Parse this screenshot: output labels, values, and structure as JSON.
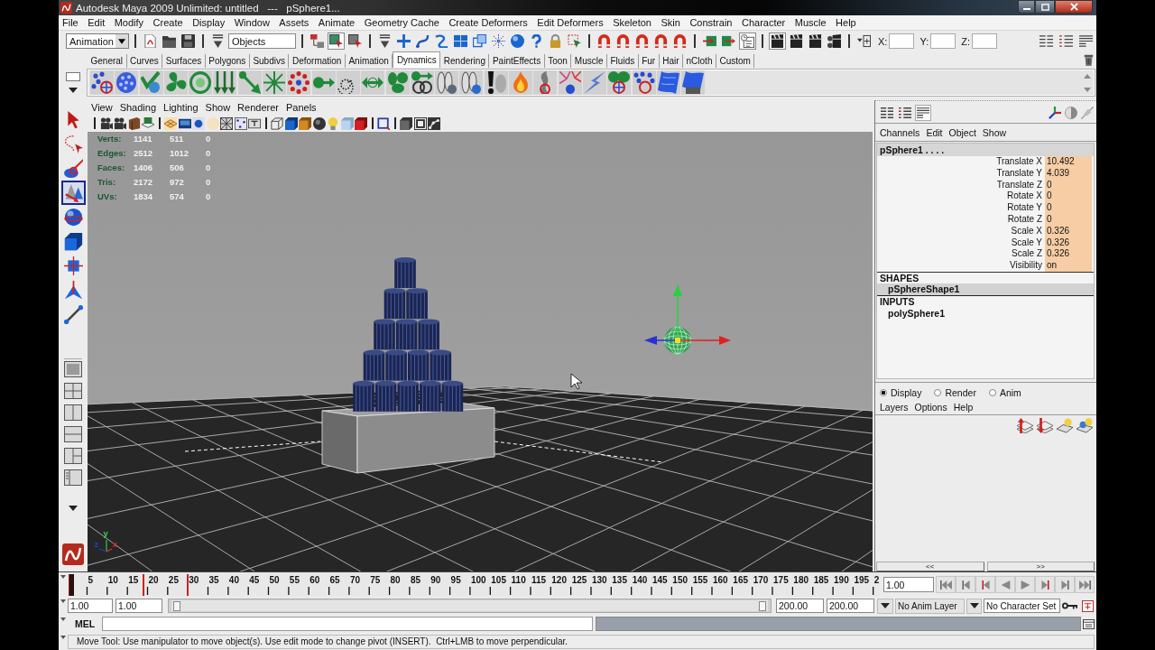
{
  "window": {
    "title": "Autodesk Maya 2009 Unlimited: untitled   ---   pSphere1..."
  },
  "menu_bar": [
    "File",
    "Edit",
    "Modify",
    "Create",
    "Display",
    "Window",
    "Assets",
    "Animate",
    "Geometry Cache",
    "Create Deformers",
    "Edit Deformers",
    "Skeleton",
    "Skin",
    "Constrain",
    "Character",
    "Muscle",
    "Help"
  ],
  "status_line": {
    "menu_set": "Animation",
    "selection_mask": "Objects",
    "buttons": [
      {
        "pressed": false
      },
      {
        "pressed": false
      },
      {
        "pressed": false
      },
      {
        "pressed": false
      },
      {
        "pressed": false
      },
      {
        "pressed": true
      },
      {
        "pressed": false
      },
      {
        "pressed": false
      },
      {
        "pressed": false
      },
      {
        "pressed": false
      },
      {
        "pressed": false
      },
      {
        "pressed": false
      },
      {
        "pressed": false
      },
      {
        "pressed": false
      },
      {
        "pressed": false
      },
      {
        "pressed": false
      },
      {
        "pressed": false
      },
      {
        "pressed": false
      },
      {
        "pressed": false
      },
      {
        "pressed": false
      },
      {
        "pressed": false
      },
      {
        "pressed": false
      },
      {
        "pressed": false
      },
      {
        "pressed": false
      },
      {
        "pressed": false
      },
      {
        "pressed": true
      },
      {
        "pressed": true
      },
      {
        "pressed": false
      },
      {
        "pressed": false
      },
      {
        "pressed": false
      },
      {
        "pressed": false
      },
      {
        "pressed": false
      },
      {
        "pressed": false
      },
      {
        "pressed": false
      }
    ],
    "coordinates": [
      {
        "label": "X:"
      },
      {
        "label": "Y:"
      },
      {
        "label": "Z:"
      }
    ]
  },
  "shelf": {
    "tabs": [
      {
        "label": "General",
        "selected": false
      },
      {
        "label": "Curves",
        "selected": false
      },
      {
        "label": "Surfaces",
        "selected": false
      },
      {
        "label": "Polygons",
        "selected": false
      },
      {
        "label": "Subdivs",
        "selected": false
      },
      {
        "label": "Deformation",
        "selected": false
      },
      {
        "label": "Animation",
        "selected": false
      },
      {
        "label": "Dynamics",
        "selected": true
      },
      {
        "label": "Rendering",
        "selected": false
      },
      {
        "label": "PaintEffects",
        "selected": false
      },
      {
        "label": "Toon",
        "selected": false
      },
      {
        "label": "Muscle",
        "selected": false
      },
      {
        "label": "Fluids",
        "selected": false
      },
      {
        "label": "Fur",
        "selected": false
      },
      {
        "label": "Hair",
        "selected": false
      },
      {
        "label": "nCloth",
        "selected": false
      },
      {
        "label": "Custom",
        "selected": false
      }
    ]
  },
  "toolbox": {
    "tools": [
      {
        "selected": false
      },
      {
        "selected": false
      },
      {
        "selected": false
      },
      {
        "selected": true
      },
      {
        "selected": false
      },
      {
        "selected": false
      },
      {
        "selected": false
      },
      {
        "selected": false
      },
      {
        "selected": false
      }
    ]
  },
  "viewport": {
    "menu": [
      "View",
      "Shading",
      "Lighting",
      "Show",
      "Renderer",
      "Panels"
    ],
    "hud": [
      {
        "label": "Verts:",
        "values": [
          "1141",
          "511",
          "0"
        ]
      },
      {
        "label": "Edges:",
        "values": [
          "2512",
          "1012",
          "0"
        ]
      },
      {
        "label": "Faces:",
        "values": [
          "1406",
          "506",
          "0"
        ]
      },
      {
        "label": "Tris:",
        "values": [
          "2172",
          "972",
          "0"
        ]
      },
      {
        "label": "UVs:",
        "values": [
          "1834",
          "574",
          "0"
        ]
      }
    ],
    "sphere": {
      "selected": true
    },
    "axis_labels": [
      {
        "label": "y",
        "color": "#3ad050"
      },
      {
        "label": "z",
        "color": "#2838c8"
      },
      {
        "label": "x",
        "color": "#d83030"
      }
    ]
  },
  "channel_box": {
    "layout_buttons": [
      {
        "selected": false
      },
      {
        "selected": false
      },
      {
        "selected": true
      }
    ],
    "menu": [
      "Channels",
      "Edit",
      "Object",
      "Show"
    ],
    "node": "pSphere1 . . . .",
    "channels": [
      {
        "name": "Translate X",
        "value": "10.492",
        "keyed": true
      },
      {
        "name": "Translate Y",
        "value": "4.039",
        "keyed": true
      },
      {
        "name": "Translate Z",
        "value": "0",
        "keyed": true
      },
      {
        "name": "Rotate X",
        "value": "0",
        "keyed": true
      },
      {
        "name": "Rotate Y",
        "value": "0",
        "keyed": true
      },
      {
        "name": "Rotate Z",
        "value": "0",
        "keyed": true
      },
      {
        "name": "Scale X",
        "value": "0.326",
        "keyed": true
      },
      {
        "name": "Scale Y",
        "value": "0.326",
        "keyed": true
      },
      {
        "name": "Scale Z",
        "value": "0.326",
        "keyed": true
      },
      {
        "name": "Visibility",
        "value": "on",
        "keyed": true
      }
    ],
    "sections": [
      {
        "heading": "SHAPES",
        "nodes": [
          {
            "name": "pSphereShape1",
            "selected": true
          }
        ]
      },
      {
        "heading": "INPUTS",
        "nodes": [
          {
            "name": "polySphere1",
            "selected": false
          }
        ]
      }
    ]
  },
  "layer_editor": {
    "modes": [
      {
        "label": "Display",
        "selected": true
      },
      {
        "label": "Render",
        "selected": false
      },
      {
        "label": "Anim",
        "selected": false
      }
    ],
    "menu": [
      "Layers",
      "Options",
      "Help"
    ]
  },
  "panel_toggles": [
    "<<",
    ">>"
  ],
  "time_slider": {
    "ticks": [
      "5",
      "10",
      "15",
      "20",
      "25",
      "30",
      "35",
      "40",
      "45",
      "50",
      "55",
      "60",
      "65",
      "70",
      "75",
      "80",
      "85",
      "90",
      "95",
      "100",
      "105",
      "110",
      "115",
      "120",
      "125",
      "130",
      "135",
      "140",
      "145",
      "150",
      "155",
      "160",
      "165",
      "170",
      "175",
      "180",
      "185",
      "190",
      "195",
      "2"
    ],
    "current_time": {
      "level": 0
    },
    "keys": [
      {
        "level": 0.0905
      },
      {
        "level": 0.1457
      }
    ],
    "current_frame": "1.00"
  },
  "range_slider": {
    "start_time": "1.00",
    "playback_start": "1.00",
    "level": 1,
    "playback_end": "200.00",
    "end_time": "200.00",
    "anim_layer": "No Anim Layer",
    "character_set": "No Character Set"
  },
  "command_line": {
    "language": "MEL"
  },
  "help_line": "Move Tool: Use manipulator to move object(s). Use edit mode to change pivot (INSERT).  Ctrl+LMB to move perpendicular."
}
